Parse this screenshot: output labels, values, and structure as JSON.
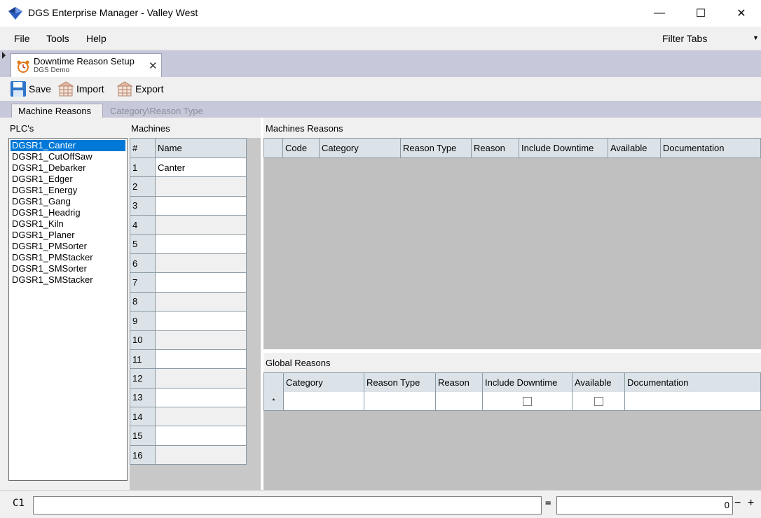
{
  "window": {
    "title": "DGS Enterprise Manager - Valley West",
    "minimize": "—",
    "maximize": "☐",
    "close": "✕"
  },
  "menu": {
    "items": [
      "File",
      "Tools",
      "Help"
    ],
    "filter_tabs": "Filter Tabs",
    "filter_arrow": "▼"
  },
  "doc_tab": {
    "title": "Downtime Reason Setup",
    "subtitle": "DGS Demo",
    "close": "✕",
    "icon": "alarm-clock-icon"
  },
  "toolbar": {
    "save": "Save",
    "import": "Import",
    "export": "Export"
  },
  "inner_tabs": {
    "machine_reasons": "Machine Reasons",
    "category_reason_type": "Category\\Reason Type"
  },
  "plcs": {
    "label": "PLC's",
    "items": [
      "DGSR1_Canter",
      "DGSR1_CutOffSaw",
      "DGSR1_Debarker",
      "DGSR1_Edger",
      "DGSR1_Energy",
      "DGSR1_Gang",
      "DGSR1_Headrig",
      "DGSR1_Kiln",
      "DGSR1_Planer",
      "DGSR1_PMSorter",
      "DGSR1_PMStacker",
      "DGSR1_SMSorter",
      "DGSR1_SMStacker"
    ],
    "selected": "DGSR1_Canter"
  },
  "machines": {
    "label": "Machines",
    "columns": [
      "#",
      "Name"
    ],
    "rows": [
      {
        "num": "1",
        "name": "Canter"
      },
      {
        "num": "2",
        "name": ""
      },
      {
        "num": "3",
        "name": ""
      },
      {
        "num": "4",
        "name": ""
      },
      {
        "num": "5",
        "name": ""
      },
      {
        "num": "6",
        "name": ""
      },
      {
        "num": "7",
        "name": ""
      },
      {
        "num": "8",
        "name": ""
      },
      {
        "num": "9",
        "name": ""
      },
      {
        "num": "10",
        "name": ""
      },
      {
        "num": "11",
        "name": ""
      },
      {
        "num": "12",
        "name": ""
      },
      {
        "num": "13",
        "name": ""
      },
      {
        "num": "14",
        "name": ""
      },
      {
        "num": "15",
        "name": ""
      },
      {
        "num": "16",
        "name": ""
      }
    ]
  },
  "machines_reasons": {
    "label": "Machines Reasons",
    "columns": [
      "",
      "Code",
      "Category",
      "Reason Type",
      "Reason",
      "Include Downtime",
      "Available",
      "Documentation"
    ]
  },
  "global_reasons": {
    "label": "Global Reasons",
    "columns": [
      "",
      "Category",
      "Reason Type",
      "Reason",
      "Include Downtime",
      "Available",
      "Documentation"
    ],
    "new_row_marker": "*"
  },
  "status": {
    "cell_ref": "C1",
    "formula": "",
    "equals": "=",
    "value": "0",
    "minus": "−",
    "plus": "+"
  }
}
